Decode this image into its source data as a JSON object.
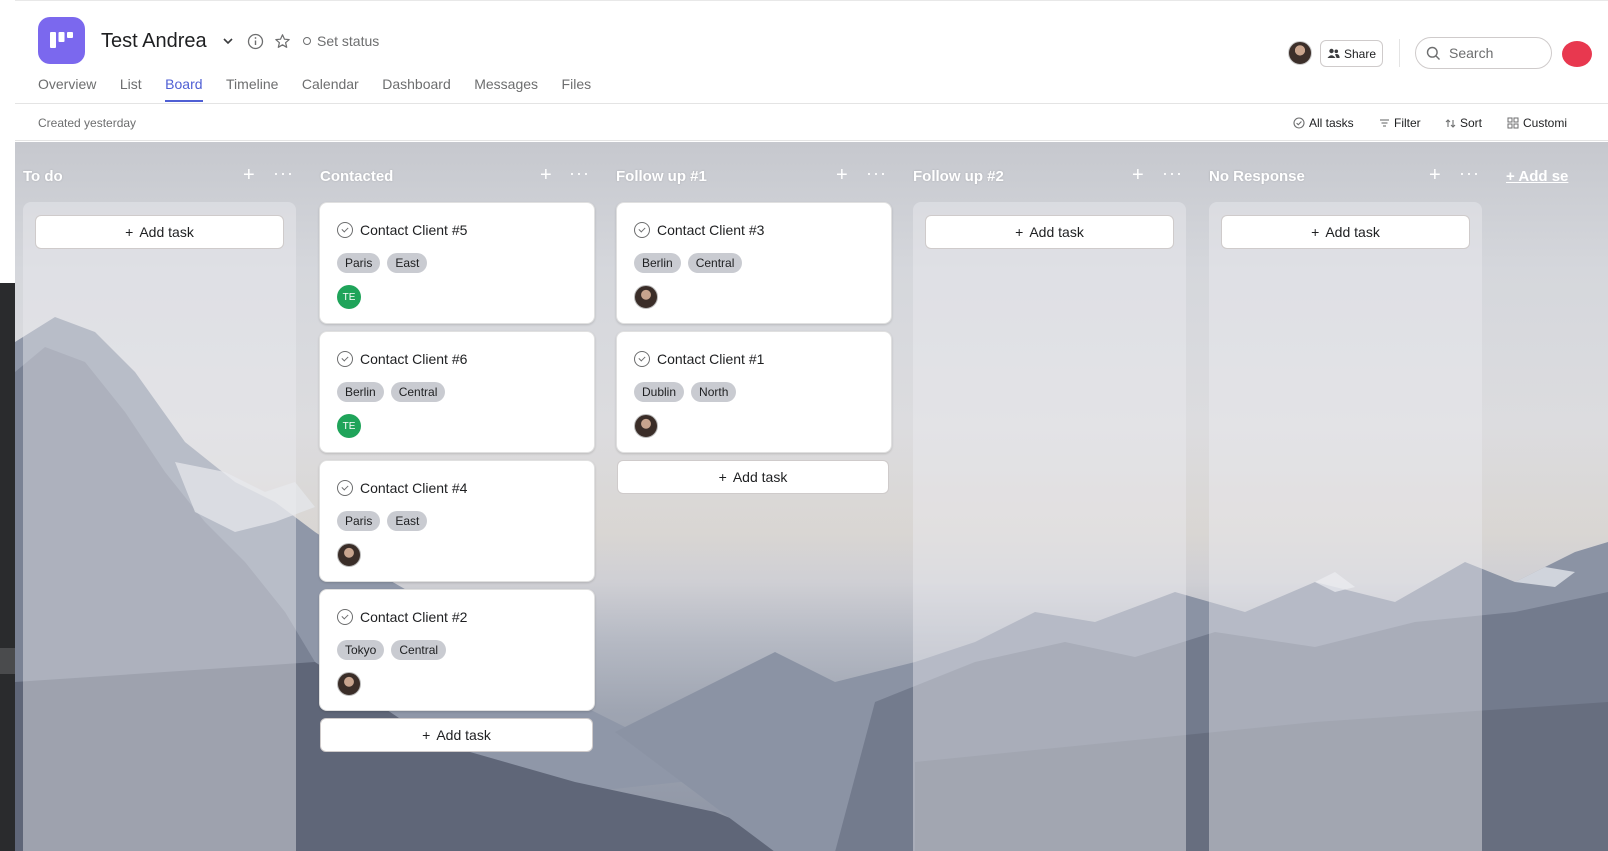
{
  "project": {
    "title": "Test Andrea",
    "set_status": "Set status",
    "accent": "#7b68ee"
  },
  "tabs": [
    {
      "label": "Overview"
    },
    {
      "label": "List"
    },
    {
      "label": "Board",
      "active": true
    },
    {
      "label": "Timeline"
    },
    {
      "label": "Calendar"
    },
    {
      "label": "Dashboard"
    },
    {
      "label": "Messages"
    },
    {
      "label": "Files"
    }
  ],
  "header_right": {
    "share_label": "Share",
    "search_placeholder": "Search"
  },
  "toolbar": {
    "created": "Created yesterday",
    "all_tasks": "All tasks",
    "filter": "Filter",
    "sort": "Sort",
    "customize": "Customi"
  },
  "board": {
    "add_task_label": "Add task",
    "add_section_label": "+ Add se",
    "columns": [
      {
        "name": "To do",
        "cards": []
      },
      {
        "name": "Contacted",
        "cards": [
          {
            "title": "Contact Client #5",
            "tags": [
              "Paris",
              "East"
            ],
            "assignee": "TE"
          },
          {
            "title": "Contact Client #6",
            "tags": [
              "Berlin",
              "Central"
            ],
            "assignee": "TE"
          },
          {
            "title": "Contact Client #4",
            "tags": [
              "Paris",
              "East"
            ],
            "assignee": "photo"
          },
          {
            "title": "Contact Client #2",
            "tags": [
              "Tokyo",
              "Central"
            ],
            "assignee": "photo"
          }
        ]
      },
      {
        "name": "Follow up #1",
        "cards": [
          {
            "title": "Contact Client #3",
            "tags": [
              "Berlin",
              "Central"
            ],
            "assignee": "photo"
          },
          {
            "title": "Contact Client #1",
            "tags": [
              "Dublin",
              "North"
            ],
            "assignee": "photo"
          }
        ]
      },
      {
        "name": "Follow up #2",
        "cards": []
      },
      {
        "name": "No Response",
        "cards": []
      }
    ]
  },
  "icons": [
    "chevron-down-icon",
    "info-icon",
    "star-icon",
    "people-icon",
    "search-icon",
    "check-circle-icon",
    "filter-icon",
    "sort-icon",
    "grid-icon",
    "plus-icon",
    "more-icon"
  ]
}
